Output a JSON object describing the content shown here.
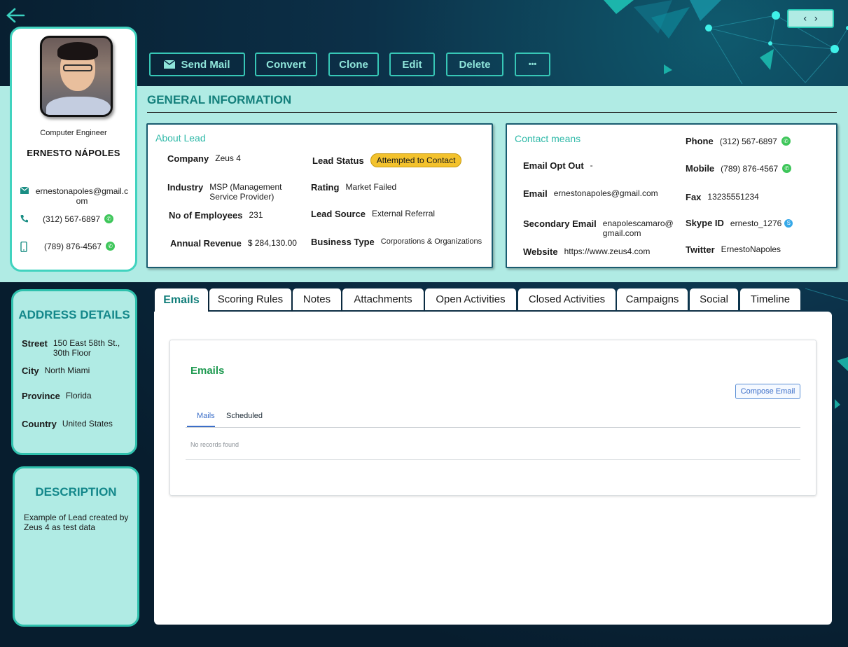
{
  "nav": {
    "prev": "‹",
    "next": "›"
  },
  "profile": {
    "job_title": "Computer Engineer",
    "name": "ERNESTO NÁPOLES",
    "email": "ernestonapoles@gmail.com",
    "phone": "(312) 567-6897",
    "mobile": "(789) 876-4567"
  },
  "actions": {
    "send_mail": "Send Mail",
    "convert": "Convert",
    "clone": "Clone",
    "edit": "Edit",
    "delete": "Delete",
    "more": "•••"
  },
  "general_title": "GENERAL INFORMATION",
  "about_lead": {
    "title": "About Lead",
    "company_label": "Company",
    "company": "Zeus 4",
    "industry_label": "Industry",
    "industry": "MSP (Management Service Provider)",
    "employees_label": "No of Employees",
    "employees": "231",
    "revenue_label": "Annual Revenue",
    "revenue": "$ 284,130.00",
    "status_label": "Lead Status",
    "status": "Attempted to Contact",
    "rating_label": "Rating",
    "rating": "Market Failed",
    "source_label": "Lead Source",
    "source": "External Referral",
    "business_label": "Business Type",
    "business": "Corporations & Organizations"
  },
  "contact_means": {
    "title": "Contact means",
    "opt_out_label": "Email Opt Out",
    "opt_out": "-",
    "email_label": "Email",
    "email": "ernestonapoles@gmail.com",
    "secondary_label": "Secondary Email",
    "secondary": "enapolescamaro@gmail.com",
    "website_label": "Website",
    "website": "https://www.zeus4.com",
    "phone_label": "Phone",
    "phone": "(312) 567-6897",
    "mobile_label": "Mobile",
    "mobile": "(789) 876-4567",
    "fax_label": "Fax",
    "fax": "13235551234",
    "skype_label": "Skype ID",
    "skype": "ernesto_1276",
    "twitter_label": "Twitter",
    "twitter": "ErnestoNapoles"
  },
  "address": {
    "title": "ADDRESS DETAILS",
    "street_label": "Street",
    "street": "150 East 58th St., 30th Floor",
    "city_label": "City",
    "city": "North Miami",
    "province_label": "Province",
    "province": "Florida",
    "country_label": "Country",
    "country": "United States"
  },
  "description": {
    "title": "DESCRIPTION",
    "text": "Example of Lead created by Zeus 4 as test data"
  },
  "tabs": [
    "Emails",
    "Scoring Rules",
    "Notes",
    "Attachments",
    "Open Activities",
    "Closed Activities",
    "Campaigns",
    "Social",
    "Timeline"
  ],
  "emails": {
    "title": "Emails",
    "compose": "Compose Email",
    "sub_tabs": [
      "Mails",
      "Scheduled"
    ],
    "empty": "No records found"
  },
  "colors": {
    "accent": "#2fc1ad",
    "band": "#b0ebe4",
    "title_teal": "#137f7b",
    "status_badge": "#f3c22d",
    "emails_green": "#1f9a51"
  }
}
